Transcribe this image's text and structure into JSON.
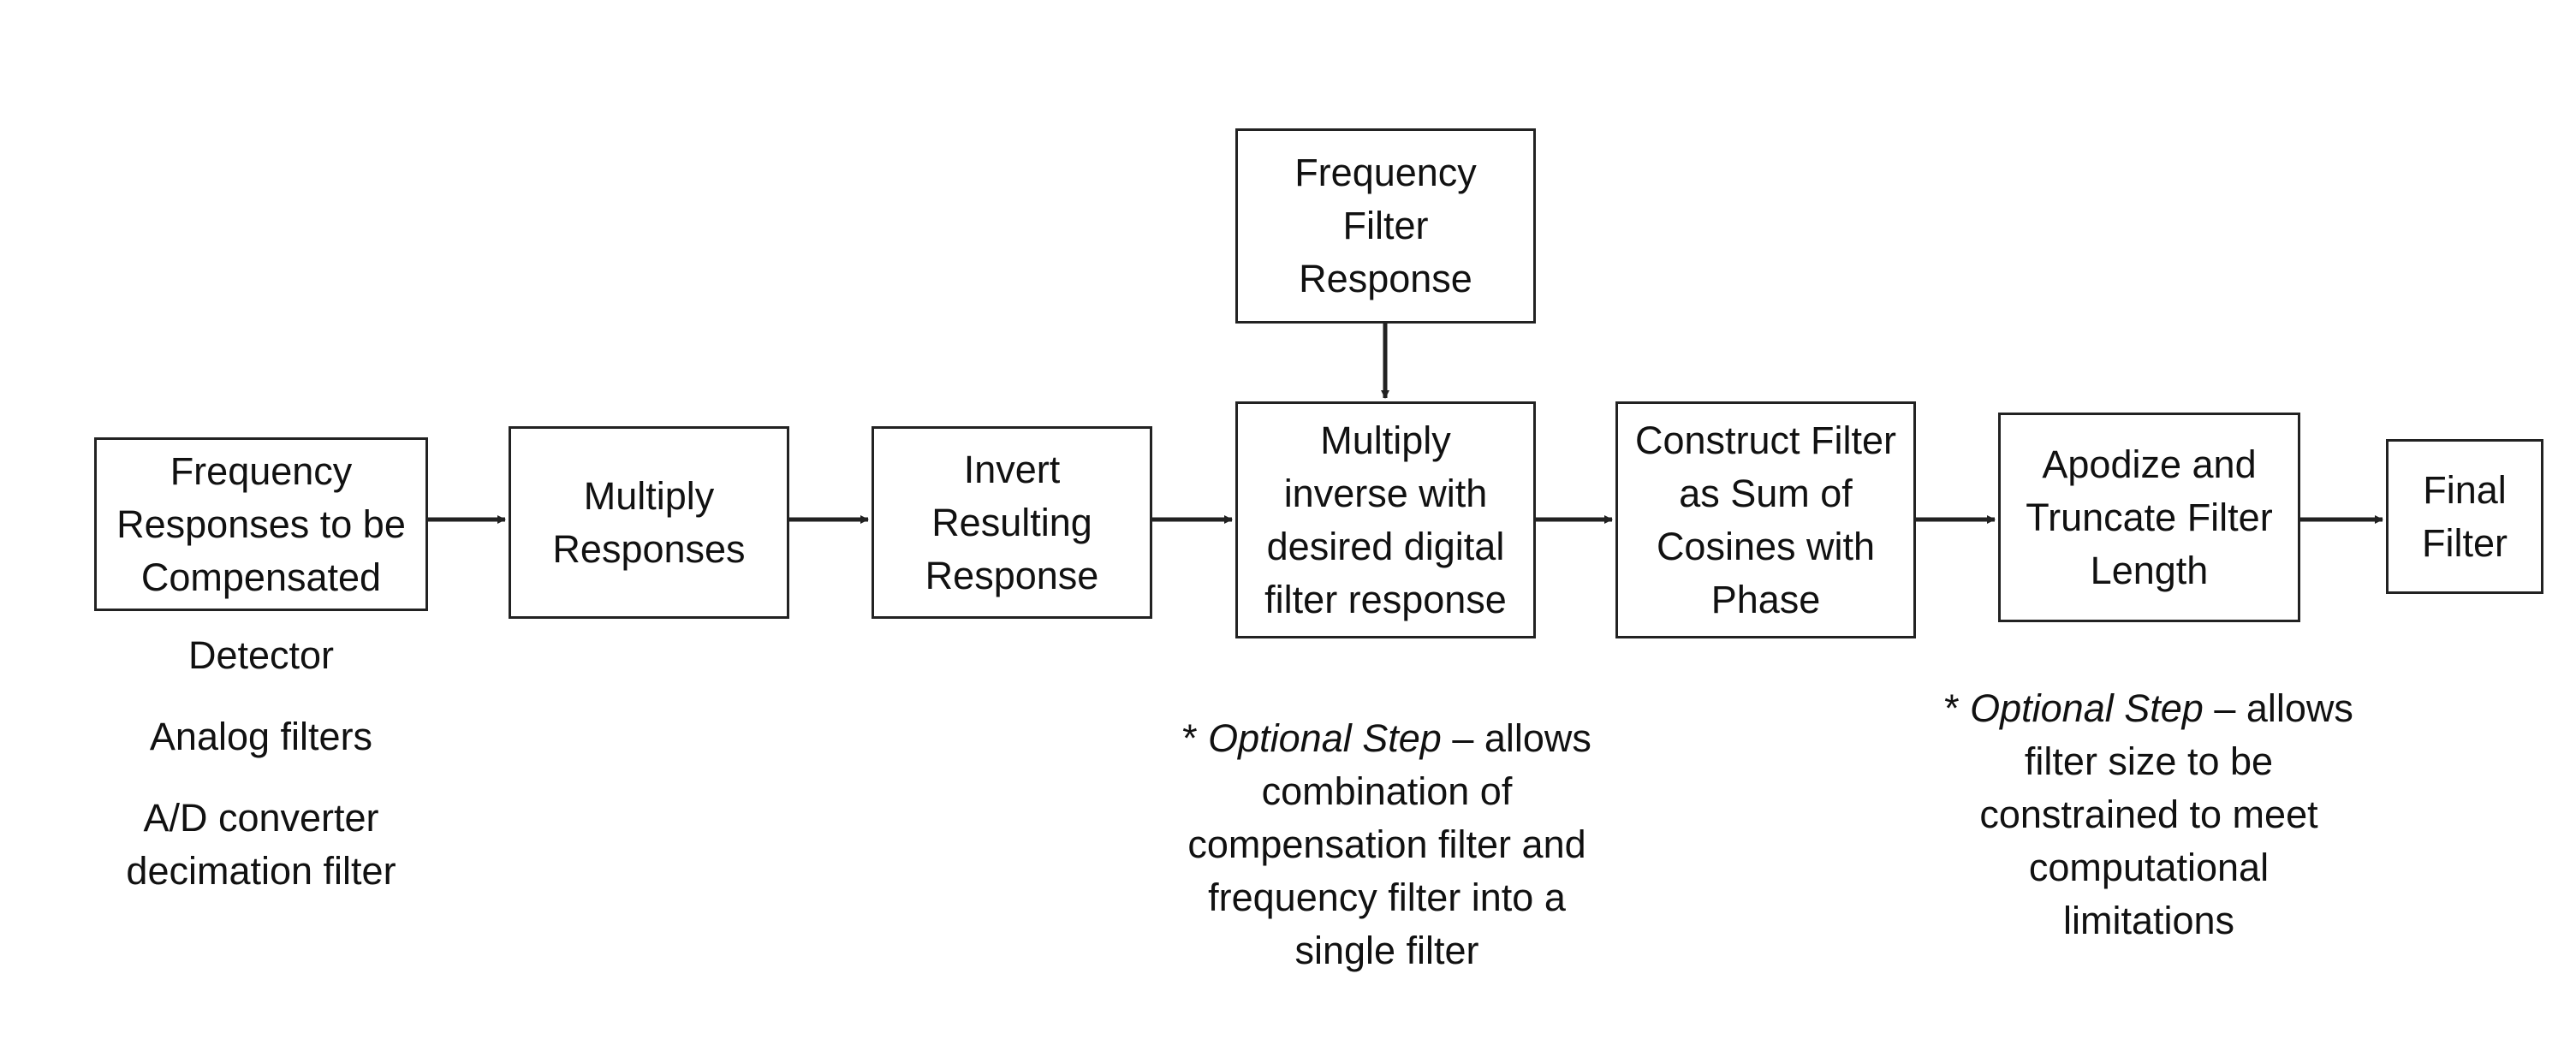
{
  "diagram": {
    "type": "flowchart",
    "nodes": [
      {
        "id": "freq-responses",
        "label": "Frequency\nResponses to be\nCompensated"
      },
      {
        "id": "multiply-responses",
        "label": "Multiply\nResponses"
      },
      {
        "id": "invert-response",
        "label": "Invert\nResulting\nResponse"
      },
      {
        "id": "multiply-inverse",
        "label": "Multiply\ninverse with\ndesired digital\nfilter response"
      },
      {
        "id": "freq-filter-response",
        "label": "Frequency\nFilter\nResponse"
      },
      {
        "id": "construct-filter",
        "label": "Construct Filter\nas Sum of\nCosines with\nPhase"
      },
      {
        "id": "apodize-truncate",
        "label": "Apodize and\nTruncate Filter\nLength"
      },
      {
        "id": "final-filter",
        "label": "Final\nFilter"
      }
    ],
    "edges": [
      {
        "from": "freq-responses",
        "to": "multiply-responses"
      },
      {
        "from": "multiply-responses",
        "to": "invert-response"
      },
      {
        "from": "invert-response",
        "to": "multiply-inverse"
      },
      {
        "from": "freq-filter-response",
        "to": "multiply-inverse"
      },
      {
        "from": "multiply-inverse",
        "to": "construct-filter"
      },
      {
        "from": "construct-filter",
        "to": "apodize-truncate"
      },
      {
        "from": "apodize-truncate",
        "to": "final-filter"
      }
    ],
    "annotations": {
      "sources": [
        "Detector",
        "Analog filters",
        "A/D converter\ndecimation filter"
      ],
      "optional_note_1": {
        "prefix": "* ",
        "emphasis": "Optional Step",
        "text": " – allows\ncombination of\ncompensation filter and\nfrequency filter into a\nsingle filter"
      },
      "optional_note_2": {
        "prefix": "* ",
        "emphasis": "Optional Step",
        "text": " – allows\nfilter size to be\nconstrained to meet\ncomputational\nlimitations"
      }
    }
  }
}
